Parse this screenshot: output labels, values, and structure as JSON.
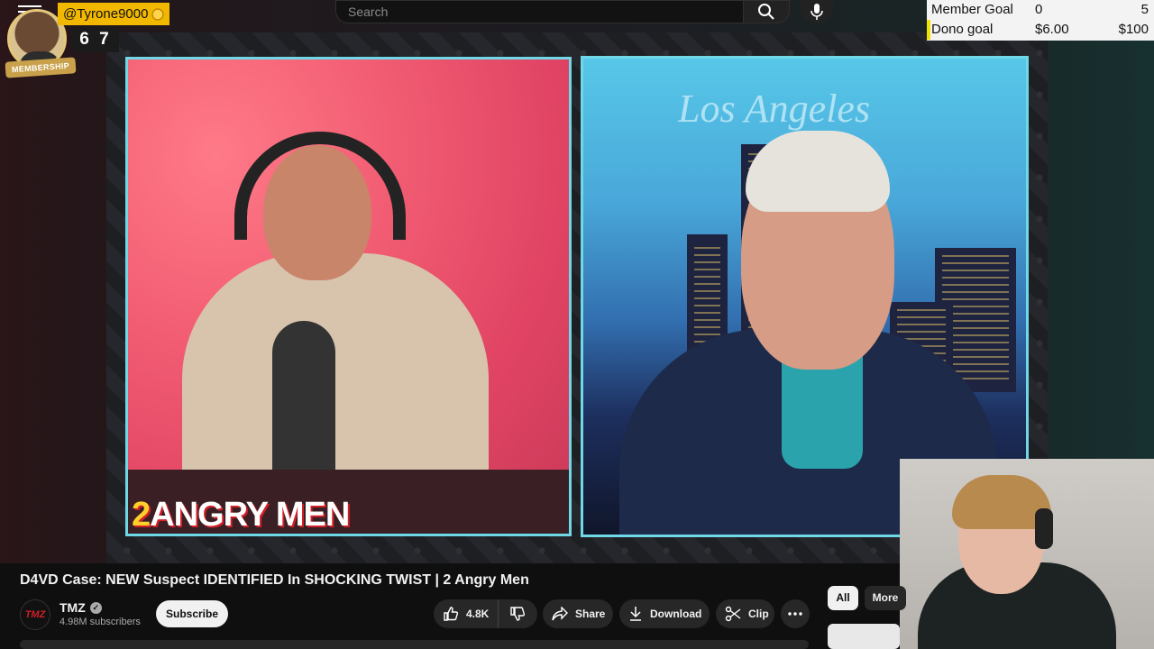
{
  "search": {
    "placeholder": "Search"
  },
  "icons": {
    "menu": "menu-icon",
    "search": "search-icon",
    "mic": "mic-icon",
    "like": "thumbs-up-icon",
    "dislike": "thumbs-down-icon",
    "share": "share-icon",
    "download": "download-icon",
    "clip": "scissors-icon",
    "more": "more-horizontal-icon",
    "verified": "verified-check-icon"
  },
  "overlay": {
    "username": "@Tyrone9000",
    "badge_label": "MEMBERSHIP",
    "counter": "6 7"
  },
  "goals": {
    "member_label": "Member Goal",
    "member_current": "0",
    "member_target": "5",
    "dono_label": "Dono goal",
    "dono_current": "$6.00",
    "dono_target": "$100"
  },
  "stream": {
    "left_logo_prefix": "2",
    "left_logo_text": "ANGRY MEN",
    "right_sign": "Los Angeles"
  },
  "video": {
    "title": "D4VD Case: NEW Suspect IDENTIFIED In SHOCKING TWIST | 2 Angry Men",
    "channel_logo_text": "TMZ",
    "channel_name": "TMZ",
    "subscribers": "4.98M subscribers",
    "subscribe_label": "Subscribe",
    "likes": "4.8K",
    "share_label": "Share",
    "download_label": "Download",
    "clip_label": "Clip"
  },
  "chips": {
    "all": "All",
    "more": "More"
  },
  "colors": {
    "accent_yellow": "#f2b800",
    "panel_border": "#6fd7e6",
    "youtube_bg": "#0f0f0f",
    "brand_red": "#d11f28"
  }
}
